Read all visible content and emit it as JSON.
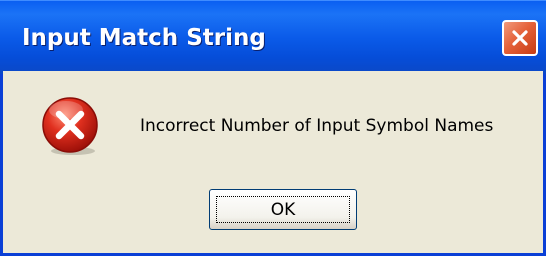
{
  "window": {
    "title": "Input Match String"
  },
  "titlebar": {
    "close_icon": "close-icon"
  },
  "dialog": {
    "icon": "error-icon",
    "message": "Incorrect Number of Input Symbol Names",
    "ok_label": "OK"
  },
  "colors": {
    "titlebar": "#0a5ae8",
    "close_button": "#e5623a",
    "dialog_background": "#ece9d8",
    "error_icon": "#d42a1c"
  }
}
